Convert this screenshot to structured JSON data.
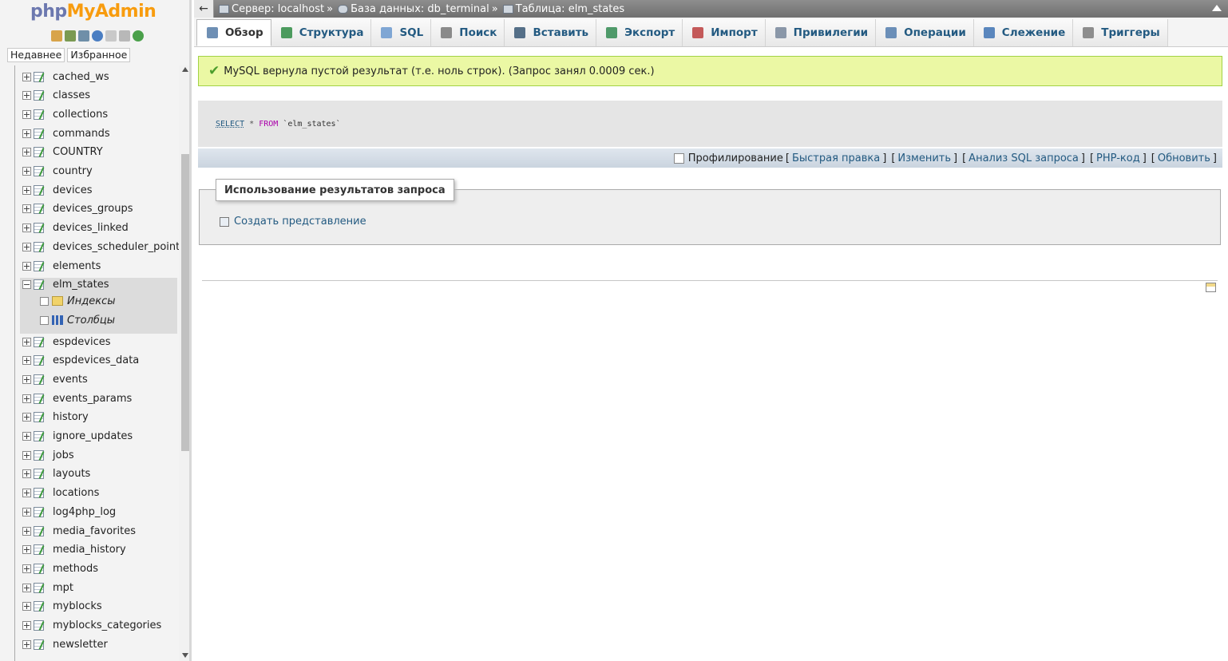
{
  "logo": {
    "php": "php",
    "myadmin": "MyAdmin"
  },
  "nav_links": {
    "recent": "Недавнее",
    "favorites": "Избранное"
  },
  "tree": {
    "tables": [
      "cached_ws",
      "classes",
      "collections",
      "commands",
      "COUNTRY",
      "country",
      "devices",
      "devices_groups",
      "devices_linked",
      "devices_scheduler_points",
      "elements",
      "elm_states"
    ],
    "expanded": {
      "indexes": "Индексы",
      "columns": "Столбцы"
    },
    "tables_after": [
      "espdevices",
      "espdevices_data",
      "events",
      "events_params",
      "history",
      "ignore_updates",
      "jobs",
      "layouts",
      "locations",
      "log4php_log",
      "media_favorites",
      "media_history",
      "methods",
      "mpt",
      "myblocks",
      "myblocks_categories",
      "newsletter"
    ]
  },
  "breadcrumb": {
    "server": "Сервер: localhost",
    "database": "База данных: db_terminal",
    "table": "Таблица: elm_states",
    "sep": "»"
  },
  "tabs": [
    {
      "label": "Обзор",
      "icon": "browse-icon",
      "color": "#6e8fb4"
    },
    {
      "label": "Структура",
      "icon": "structure-icon",
      "color": "#4c9b5e"
    },
    {
      "label": "SQL",
      "icon": "sql-icon",
      "color": "#7fa6d4"
    },
    {
      "label": "Поиск",
      "icon": "search-icon",
      "color": "#8a8a8a"
    },
    {
      "label": "Вставить",
      "icon": "insert-icon",
      "color": "#556f88"
    },
    {
      "label": "Экспорт",
      "icon": "export-icon",
      "color": "#4f9a6a"
    },
    {
      "label": "Импорт",
      "icon": "import-icon",
      "color": "#c45a5a"
    },
    {
      "label": "Привилегии",
      "icon": "privileges-icon",
      "color": "#8a97a8"
    },
    {
      "label": "Операции",
      "icon": "operations-icon",
      "color": "#6b8fb8"
    },
    {
      "label": "Слежение",
      "icon": "tracking-icon",
      "color": "#5a86bd"
    },
    {
      "label": "Триггеры",
      "icon": "triggers-icon",
      "color": "#8d8d8d"
    }
  ],
  "message": "MySQL вернула пустой результат (т.е. ноль строк). (Запрос занял 0.0009 сек.)",
  "sql": {
    "select": "SELECT",
    "star": "*",
    "from": "FROM",
    "table": "`elm_states`"
  },
  "sql_links": {
    "profiling": "Профилирование",
    "quick_edit": "Быстрая правка",
    "edit": "Изменить",
    "explain": "Анализ SQL запроса",
    "php_code": "PHP-код",
    "refresh": "Обновить",
    "open": "[",
    "close": "]"
  },
  "query_results": {
    "legend": "Использование результатов запроса",
    "create_view": "Создать представление"
  },
  "colors": {
    "accent": "#235a81",
    "success_bg": "#ebf8a4",
    "logo_php": "#6c78af",
    "logo_myadmin": "#f89c0e"
  }
}
